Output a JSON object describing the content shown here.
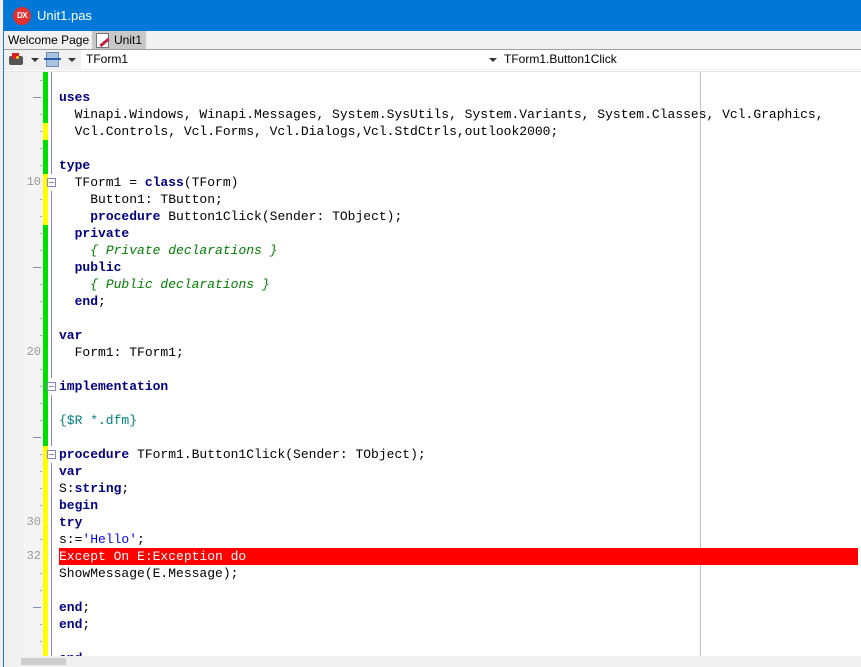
{
  "window": {
    "title": "Unit1.pas",
    "logo_text": "DX"
  },
  "tabs": [
    {
      "label": "Welcome Page",
      "active": false
    },
    {
      "label": "Unit1",
      "active": true,
      "icon": "unit-file-icon"
    }
  ],
  "toolbar": {
    "icons": [
      "component-palette-icon",
      "structure-view-icon"
    ],
    "class_combo": "TForm1",
    "method_combo": "TForm1.Button1Click"
  },
  "colors": {
    "titlebar": "#0078d7",
    "change_saved": "#00e000",
    "change_unsaved": "#ffff00",
    "error_highlight": "#ff0000",
    "keyword": "#000080",
    "comment": "#008000",
    "string": "#0000ff"
  },
  "editor": {
    "error_line": 32,
    "lines": [
      {
        "num": "",
        "mark": "dot",
        "change": "green",
        "html": ""
      },
      {
        "num": "",
        "mark": "dash",
        "change": "green",
        "html": "<span class='kw'>uses</span>"
      },
      {
        "num": "",
        "mark": "dot",
        "change": "green",
        "html": "  Winapi.Windows, Winapi.Messages, System.SysUtils, System.Variants, System.Classes, Vcl.Graphics,"
      },
      {
        "num": "",
        "mark": "dot",
        "change": "yellow",
        "html": "  Vcl.Controls, Vcl.Forms, Vcl.Dialogs,Vcl.StdCtrls,outlook2000;"
      },
      {
        "num": "",
        "mark": "dot",
        "change": "green",
        "html": ""
      },
      {
        "num": "",
        "mark": "dot",
        "change": "green",
        "html": "<span class='kw'>type</span>"
      },
      {
        "num": "10",
        "mark": "",
        "change": "yellow",
        "fold": true,
        "html": "  TForm1 = <span class='kw'>class</span>(TForm)"
      },
      {
        "num": "",
        "mark": "dot",
        "change": "yellow",
        "html": "    Button1: TButton;"
      },
      {
        "num": "",
        "mark": "dot",
        "change": "yellow",
        "html": "    <span class='kw'>procedure</span> Button1Click(Sender: TObject);"
      },
      {
        "num": "",
        "mark": "dot",
        "change": "green",
        "html": "  <span class='kw'>private</span>"
      },
      {
        "num": "",
        "mark": "dot",
        "change": "green",
        "html": "    <span class='cm'>{ Private declarations }</span>"
      },
      {
        "num": "",
        "mark": "dash",
        "change": "green",
        "html": "  <span class='kw'>public</span>"
      },
      {
        "num": "",
        "mark": "dot",
        "change": "green",
        "html": "    <span class='cm'>{ Public declarations }</span>"
      },
      {
        "num": "",
        "mark": "dot",
        "change": "green",
        "html": "  <span class='kw'>end</span>;"
      },
      {
        "num": "",
        "mark": "dot",
        "change": "green",
        "html": ""
      },
      {
        "num": "",
        "mark": "dot",
        "change": "green",
        "html": "<span class='kw'>var</span>"
      },
      {
        "num": "20",
        "mark": "",
        "change": "green",
        "html": "  Form1: TForm1;"
      },
      {
        "num": "",
        "mark": "dot",
        "change": "green",
        "html": ""
      },
      {
        "num": "",
        "mark": "dot",
        "change": "green",
        "fold": true,
        "html": "<span class='kw'>implementation</span>"
      },
      {
        "num": "",
        "mark": "dot",
        "change": "green",
        "html": ""
      },
      {
        "num": "",
        "mark": "dot",
        "change": "green",
        "html": "<span class='dir'>{$R *.dfm}</span>"
      },
      {
        "num": "",
        "mark": "dash",
        "change": "green",
        "html": ""
      },
      {
        "num": "",
        "mark": "dot",
        "change": "yellow",
        "fold": true,
        "html": "<span class='kw'>procedure</span> TForm1.Button1Click(Sender: TObject);"
      },
      {
        "num": "",
        "mark": "dot",
        "change": "yellow",
        "html": "<span class='kw'>var</span>"
      },
      {
        "num": "",
        "mark": "dot",
        "change": "yellow",
        "html": "S:<span class='kw'>string</span>;"
      },
      {
        "num": "",
        "mark": "dot",
        "change": "yellow",
        "html": "<span class='kw'>begin</span>"
      },
      {
        "num": "30",
        "mark": "",
        "change": "yellow",
        "html": "<span class='kw'>try</span>"
      },
      {
        "num": "",
        "mark": "dot",
        "change": "yellow",
        "html": "s:=<span class='str'>'Hello'</span>;"
      },
      {
        "num": "32",
        "mark": "",
        "change": "yellow",
        "error": true,
        "html": "Except On E:Exception do"
      },
      {
        "num": "",
        "mark": "dot",
        "change": "yellow",
        "html": "ShowMessage(E.Message);"
      },
      {
        "num": "",
        "mark": "dot",
        "change": "yellow",
        "html": ""
      },
      {
        "num": "",
        "mark": "dash",
        "change": "yellow",
        "html": "<span class='kw'>end</span>;"
      },
      {
        "num": "",
        "mark": "dot",
        "change": "yellow",
        "html": "<span class='kw'>end</span>;"
      },
      {
        "num": "",
        "mark": "dot",
        "change": "yellow",
        "html": ""
      },
      {
        "num": "",
        "mark": "dot",
        "change": "yellow",
        "html": "<span class='kw'>end</span>."
      }
    ]
  }
}
